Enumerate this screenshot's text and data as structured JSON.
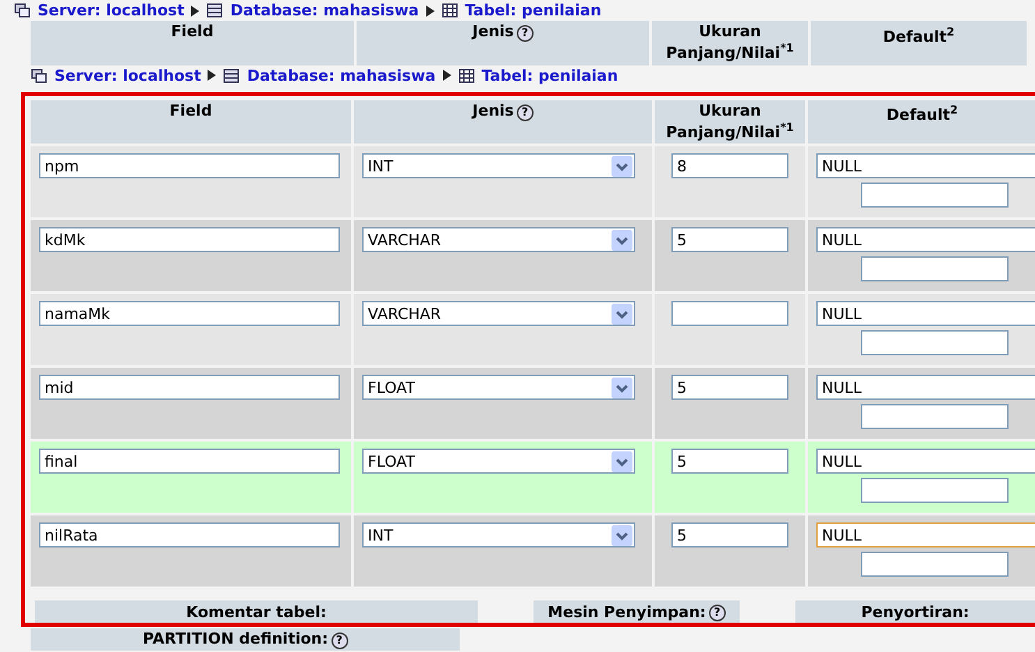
{
  "breadcrumb": [
    {
      "kind": "server",
      "label": "Server: localhost"
    },
    {
      "kind": "database",
      "label": "Database: mahasiswa"
    },
    {
      "kind": "table",
      "label": "Tabel: penilaian"
    }
  ],
  "back_columns": [
    {
      "label": "Field"
    },
    {
      "label": "Jenis",
      "help": "?"
    },
    {
      "label": "Ukuran",
      "sublabel": "Panjang/Nilai$^{*1}$"
    },
    {
      "label": "Default$^{2}$"
    }
  ],
  "breadcrumb_2": [
    {
      "kind": "server",
      "label": "Server: localhost"
    },
    {
      "kind": "database",
      "label": "Database: mahasiswa"
    },
    {
      "kind": "table",
      "label": "Tabel: penilaian"
    }
  ],
  "columns": [
    {
      "label": "Field"
    },
    {
      "label": "Jenis",
      "help": "?"
    },
    {
      "label": "Ukuran",
      "sublabel": "Panjang/Nilai$^{*1}$"
    },
    {
      "label": "Default$^{2}$"
    }
  ],
  "rows": [
    {
      "name": "npm",
      "type": "INT",
      "length": "8",
      "default": "NULL",
      "highlighted": false,
      "focused": false
    },
    {
      "name": "kdMk",
      "type": "VARCHAR",
      "length": "5",
      "default": "NULL",
      "highlighted": false,
      "focused": false
    },
    {
      "name": "namaMk",
      "type": "VARCHAR",
      "length": "",
      "default": "NULL",
      "highlighted": false,
      "focused": false
    },
    {
      "name": "mid",
      "type": "FLOAT",
      "length": "5",
      "default": "NULL",
      "highlighted": false,
      "focused": false
    },
    {
      "name": "final",
      "type": "FLOAT",
      "length": "5",
      "default": "NULL",
      "highlighted": true,
      "focused": false
    },
    {
      "name": "nilRata",
      "type": "INT",
      "length": "5",
      "default": "NULL",
      "highlighted": false,
      "focused": true
    }
  ],
  "footer": [
    {
      "label": "Komentar tabel:"
    },
    {
      "label": "Mesin Penyimpan:",
      "help": "?"
    },
    {
      "label": "Penyortiran:"
    }
  ],
  "partition": {
    "label": "PARTITION definition:",
    "help": "?"
  }
}
